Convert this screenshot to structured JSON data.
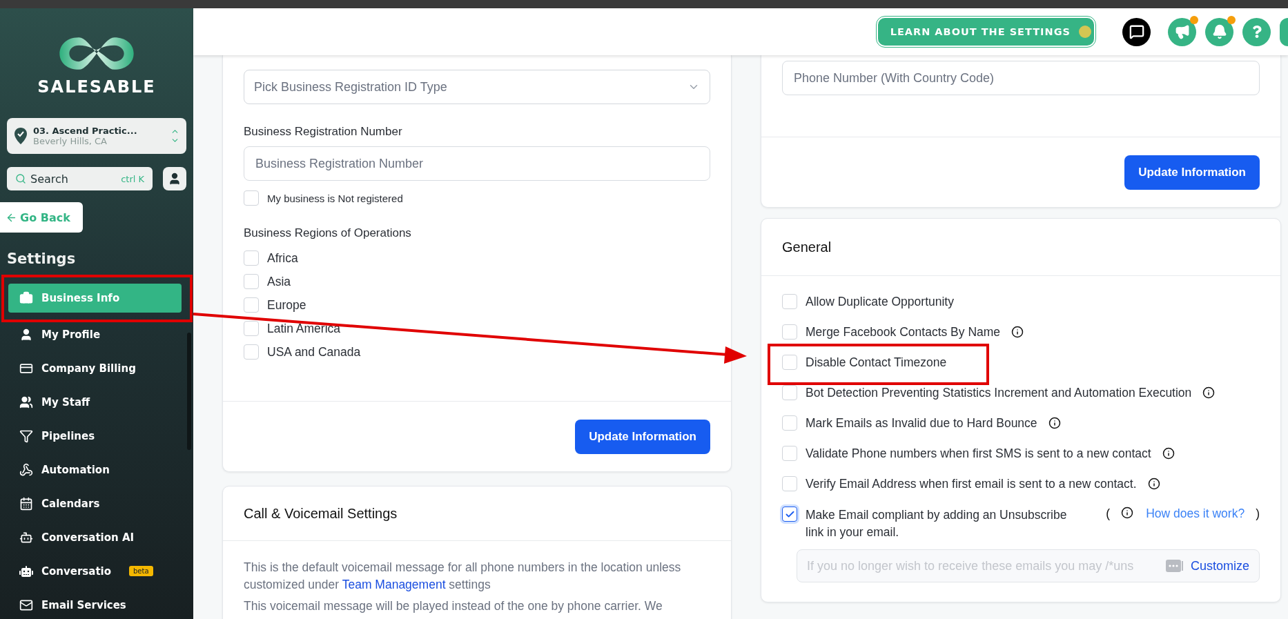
{
  "sidebar": {
    "brand": "SALESABLE",
    "location": {
      "name": "03. Ascend Practic...",
      "city": "Beverly Hills, CA"
    },
    "search": {
      "placeholder": "Search",
      "shortcut": "ctrl K"
    },
    "back_button": "Go Back",
    "section_title": "Settings",
    "items": [
      {
        "label": "Business Info",
        "selected": true
      },
      {
        "label": "My Profile",
        "selected": false
      },
      {
        "label": "Company Billing",
        "selected": false
      },
      {
        "label": "My Staff",
        "selected": false
      },
      {
        "label": "Pipelines",
        "selected": false
      },
      {
        "label": "Automation",
        "selected": false
      },
      {
        "label": "Calendars",
        "selected": false
      },
      {
        "label": "Conversation AI",
        "selected": false
      },
      {
        "label": "Conversatio",
        "selected": false,
        "badge": "beta"
      },
      {
        "label": "Email Services",
        "selected": false
      }
    ]
  },
  "header": {
    "learn_button": "LEARN ABOUT THE SETTINGS",
    "buttons": [
      {
        "unread": false
      },
      {
        "unread": true
      },
      {
        "unread": true
      },
      {
        "unread": false
      }
    ]
  },
  "business_card": {
    "id_type": {
      "placeholder": "Pick Business Registration ID Type"
    },
    "number": {
      "label": "Business Registration Number",
      "placeholder": "Business Registration Number"
    },
    "not_registered": {
      "label": "My business is Not registered",
      "checked": false
    },
    "regions": {
      "label": "Business Regions of Operations",
      "options": [
        {
          "label": "Africa",
          "checked": false
        },
        {
          "label": "Asia",
          "checked": false
        },
        {
          "label": "Europe",
          "checked": false
        },
        {
          "label": "Latin America",
          "checked": false
        },
        {
          "label": "USA and Canada",
          "checked": false
        }
      ]
    },
    "button": "Update Information"
  },
  "voicemail_card": {
    "title": "Call & Voicemail Settings",
    "paragraph_1": {
      "before": "This is the default voicemail message for all phone numbers in the location unless customized under ",
      "link": "Team Management",
      "after": " settings"
    },
    "paragraph_2": "This voicemail message will be played instead of the one by phone carrier. We"
  },
  "phone_card": {
    "phone": {
      "placeholder": "Phone Number (With Country Code)"
    },
    "button": "Update Information"
  },
  "general_card": {
    "title": "General",
    "options": [
      {
        "label": "Allow Duplicate Opportunity",
        "checked": false,
        "info": false
      },
      {
        "label": "Merge Facebook Contacts By Name",
        "checked": false,
        "info": true
      },
      {
        "label": "Disable Contact Timezone",
        "checked": false,
        "info": false
      },
      {
        "label": "Bot Detection Preventing Statistics Increment and Automation Execution",
        "checked": false,
        "info": true
      },
      {
        "label": "Mark Emails as Invalid due to Hard Bounce",
        "checked": false,
        "info": true
      },
      {
        "label": "Validate Phone numbers when first SMS is sent to a new contact",
        "checked": false,
        "info": true
      },
      {
        "label": "Verify Email Address when first email is sent to a new contact.",
        "checked": false,
        "info": true
      },
      {
        "label": "Make Email compliant by adding an Unsubscribe link in your email.",
        "checked": true,
        "info": true,
        "open_paren": "(",
        "link": "How does it work?",
        "close_paren": ")"
      }
    ],
    "unsubscribe": {
      "placeholder": "If you no longer wish to receive these emails you may /*uns",
      "button": "Customize"
    }
  }
}
